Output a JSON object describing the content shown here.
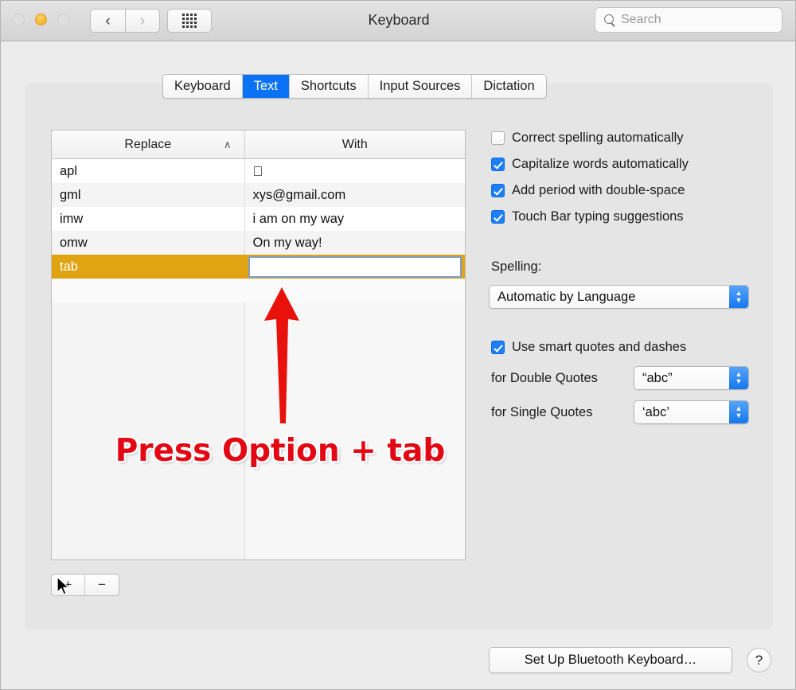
{
  "window": {
    "title": "Keyboard",
    "traffic_lights": [
      "close",
      "minimize",
      "zoom"
    ],
    "nav_back_icon": "‹",
    "nav_forward_icon": "›",
    "grid_icon": "grid-icon",
    "search_placeholder": "Search",
    "search_value": ""
  },
  "tabs": [
    {
      "label": "Keyboard",
      "active": false
    },
    {
      "label": "Text",
      "active": true
    },
    {
      "label": "Shortcuts",
      "active": false
    },
    {
      "label": "Input Sources",
      "active": false
    },
    {
      "label": "Dictation",
      "active": false
    }
  ],
  "table": {
    "columns": [
      "Replace",
      "With"
    ],
    "sort_column": "Replace",
    "sort_direction_icon": "∧",
    "rows": [
      {
        "replace": "apl",
        "with": "",
        "selected": false,
        "editing": false
      },
      {
        "replace": "gml",
        "with": "xys@gmail.com",
        "selected": false,
        "editing": false
      },
      {
        "replace": "imw",
        "with": "i am on my way",
        "selected": false,
        "editing": false
      },
      {
        "replace": "omw",
        "with": "On my way!",
        "selected": false,
        "editing": false
      },
      {
        "replace": "tab",
        "with": "",
        "selected": true,
        "editing": true
      }
    ],
    "add_button_label": "+",
    "remove_button_label": "−"
  },
  "options": {
    "checkboxes": [
      {
        "label": "Correct spelling automatically",
        "checked": false
      },
      {
        "label": "Capitalize words automatically",
        "checked": true
      },
      {
        "label": "Add period with double-space",
        "checked": true
      },
      {
        "label": "Touch Bar typing suggestions",
        "checked": true
      }
    ],
    "spelling_label": "Spelling:",
    "spelling_value": "Automatic by Language",
    "smart_quotes": {
      "label": "Use smart quotes and dashes",
      "checked": true
    },
    "double_quotes_label": "for Double Quotes",
    "double_quotes_value": "“abc”",
    "single_quotes_label": "for Single Quotes",
    "single_quotes_value": "‘abc’"
  },
  "footer": {
    "bluetooth_button": "Set Up Bluetooth Keyboard…",
    "help_button": "?"
  },
  "annotation": {
    "text": "Press Option + tab",
    "arrow": "red-up-arrow",
    "color": "#e30613"
  }
}
